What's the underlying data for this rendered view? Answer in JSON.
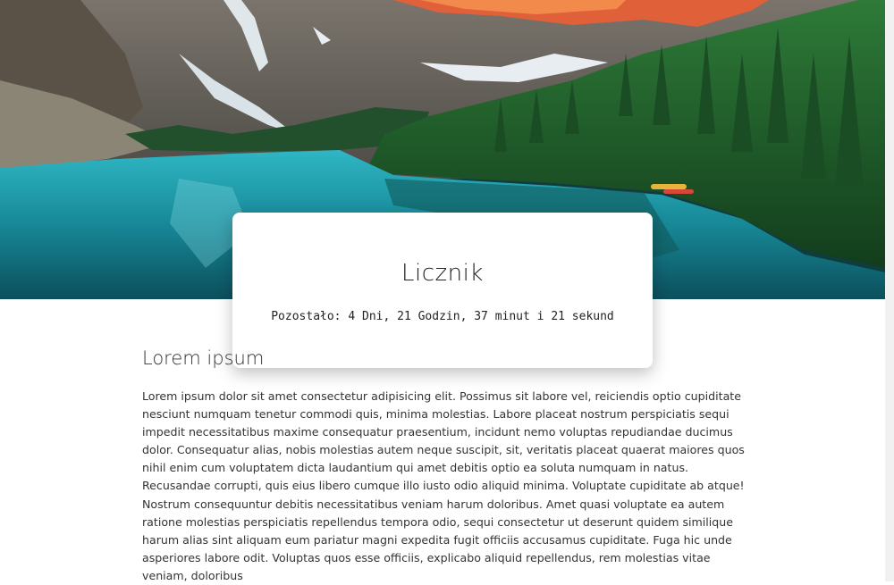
{
  "card": {
    "title": "Licznik",
    "counter_prefix": "Pozostało:",
    "counter_text": "4 Dni, 21 Godzin, 37 minut i 21 sekund"
  },
  "article": {
    "heading": "Lorem ipsum",
    "body": "Lorem ipsum dolor sit amet consectetur adipisicing elit. Possimus sit labore vel, reiciendis optio cupiditate nesciunt numquam tenetur commodi quis, minima molestias. Labore placeat nostrum perspiciatis sequi impedit necessitatibus maxime consequatur praesentium, incidunt nemo voluptas repudiandae ducimus dolor. Consequatur alias, nobis molestias autem neque suscipit, sit, veritatis placeat quaerat maiores quos nihil enim cum voluptatem dicta laudantium qui amet debitis optio ea soluta numquam in natus. Recusandae corrupti, quis eius libero cumque illo iusto odio aliquid minima. Voluptate cupiditate ab atque! Nostrum consequuntur debitis necessitatibus veniam harum doloribus. Amet quasi voluptate ea autem ratione molestias perspiciatis repellendus tempora odio, sequi consectetur ut deserunt quidem similique harum alias sint aliquam eum pariatur magni expedita fugit officiis accusamus cupiditate. Fuga hic unde asperiores labore odit. Voluptas quos esse officiis, explicabo aliquid repellendus, rem molestias vitae veniam, doloribus"
  },
  "colors": {
    "lake": "#1a8a9a",
    "forest": "#1f5a2a",
    "mountain": "#6b6862",
    "sunlit_peak": "#e8683a",
    "snow": "#e8eef0"
  }
}
